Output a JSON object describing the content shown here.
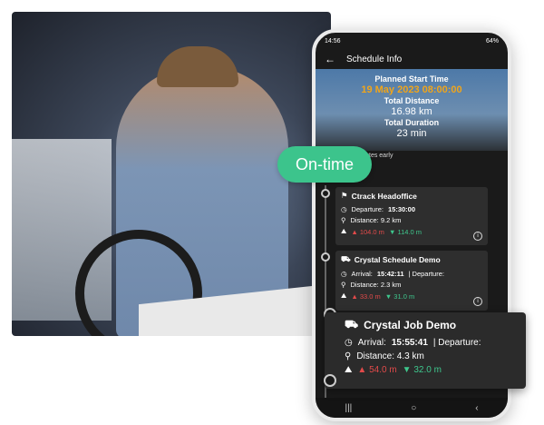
{
  "status_bar": {
    "time": "14:56",
    "battery": "64%"
  },
  "appbar": {
    "title": "Schedule Info"
  },
  "summary": {
    "planned_start_label": "Planned Start Time",
    "planned_start_value": "19 May 2023 08:00:00",
    "total_distance_label": "Total Distance",
    "total_distance_value": "16.98 km",
    "total_duration_label": "Total Duration",
    "total_duration_value": "23 min",
    "early_text": "0 minutes early"
  },
  "badge": {
    "label": "On-time"
  },
  "stops": [
    {
      "name": "Ctrack Headoffice",
      "time_label": "Departure:",
      "time_value": "15:30:00",
      "distance": "Distance: 9.2 km",
      "elev_up": "104.0 m",
      "elev_down": "114.0 m"
    },
    {
      "name": "Crystal Schedule Demo",
      "time_label": "Arrival:",
      "time_value": "15:42:11",
      "time_suffix": "| Departure:",
      "distance": "Distance: 2.3 km",
      "elev_up": "33.0 m",
      "elev_down": "31.0 m"
    },
    {
      "name": "Crystal Job Demo",
      "time_label": "Arrival:",
      "time_value": "15:55:41",
      "time_suffix": "| Departure:",
      "distance": "Distance: 4.3 km",
      "elev_up": "54.0 m",
      "elev_down": "32.0 m"
    }
  ],
  "colors": {
    "accent": "#3cc48c",
    "time": "#f0a51b",
    "up": "#e24a4a",
    "down": "#3ec78d"
  }
}
